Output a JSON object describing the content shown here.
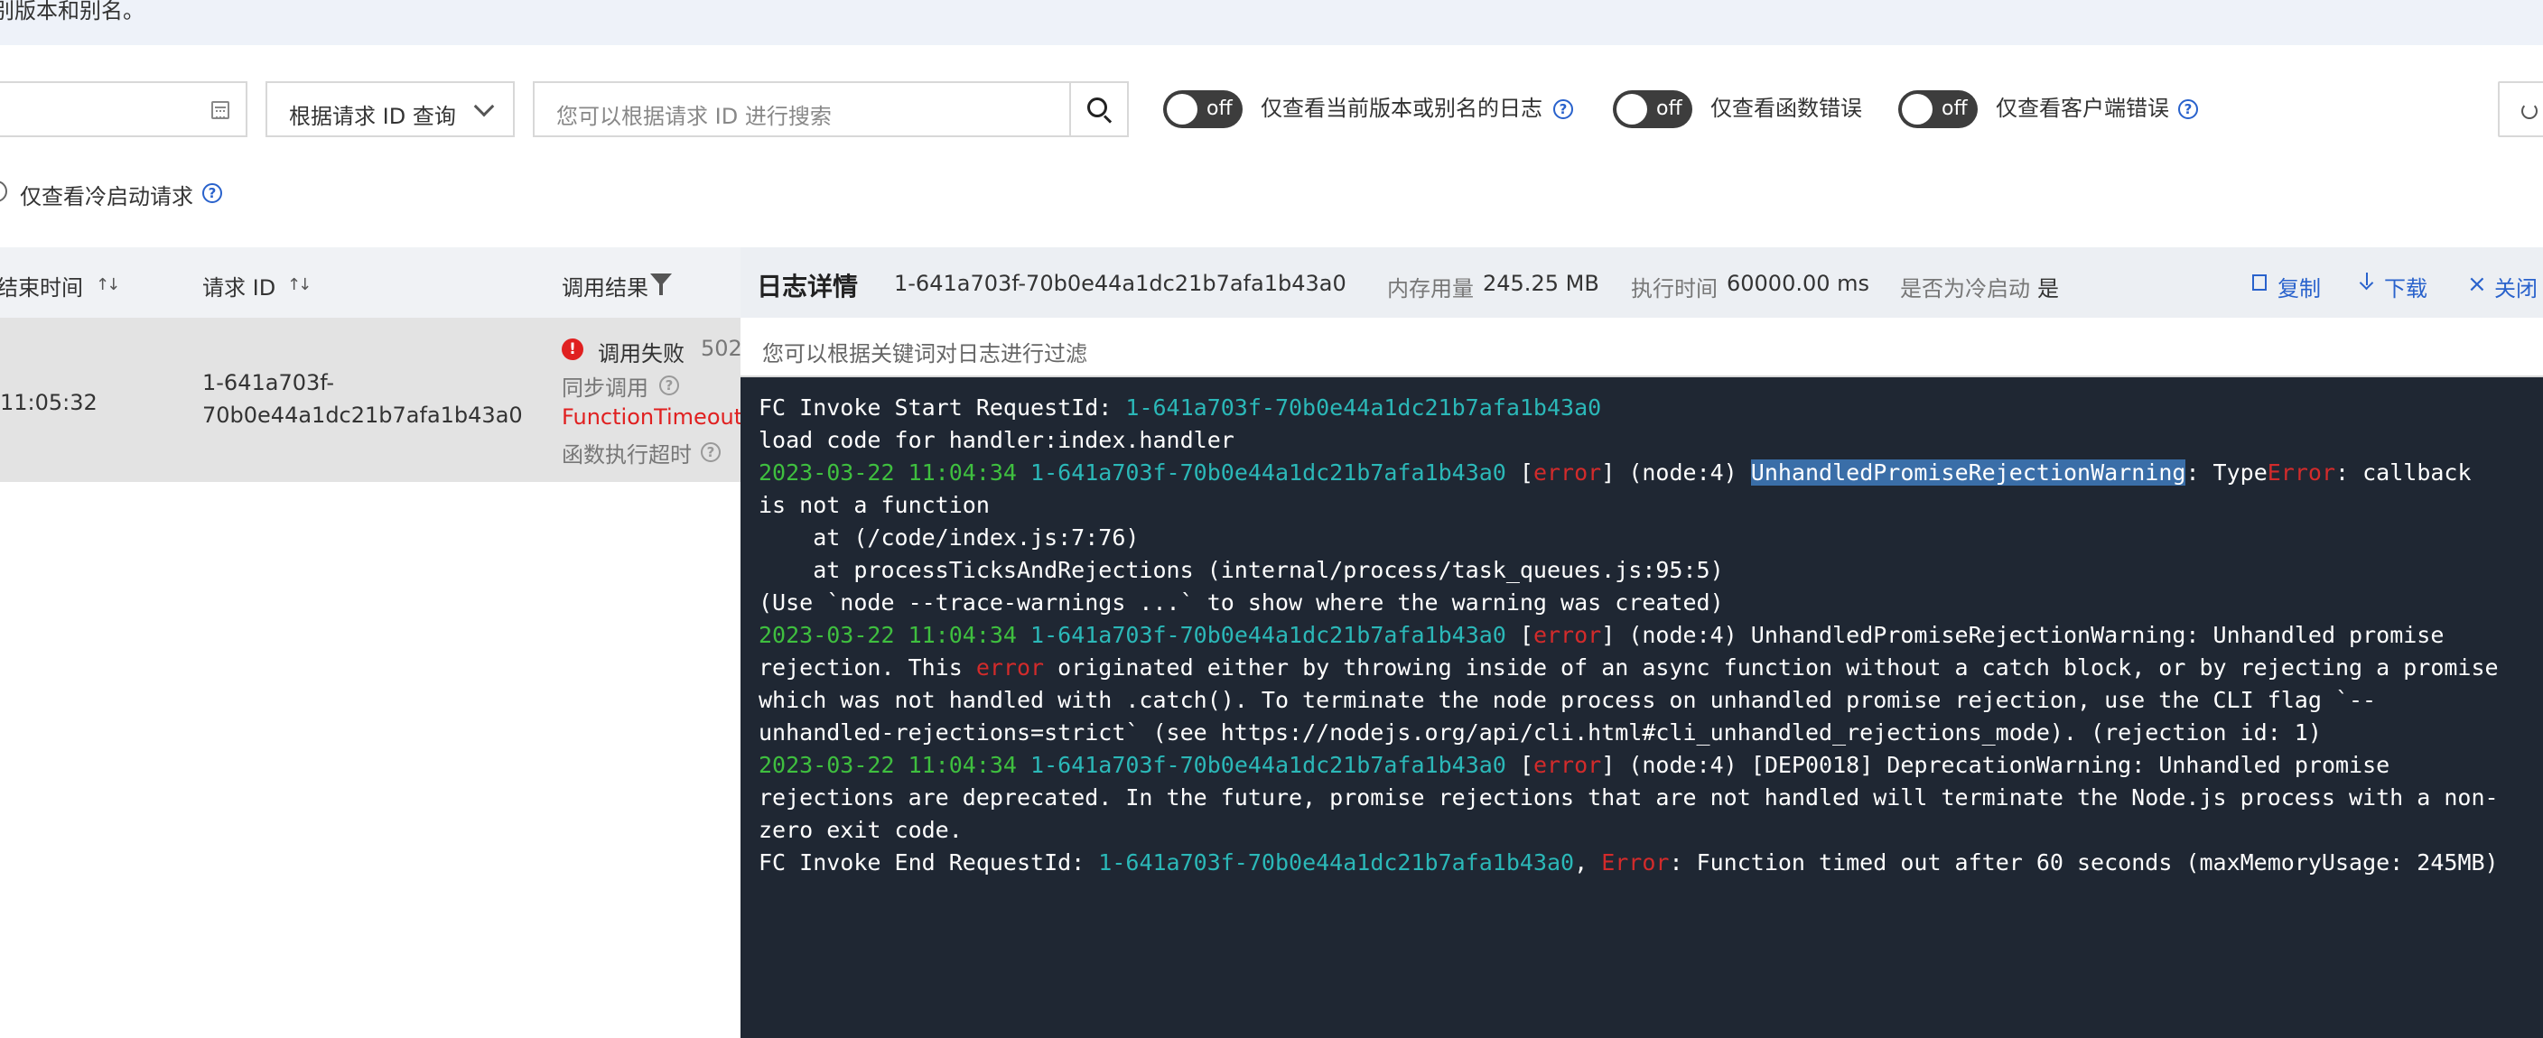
{
  "notice": {
    "text": "别版本和别名。"
  },
  "toolbar": {
    "date_value": "",
    "query_type": "根据请求 ID 查询",
    "search_placeholder": "您可以根据请求 ID 进行搜索",
    "toggle_off_label": "off",
    "toggle_version": "仅查看当前版本或别名的日志",
    "toggle_func_error": "仅查看函数错误",
    "toggle_client_error": "仅查看客户端错误",
    "cold_start": "仅查看冷启动请求"
  },
  "table": {
    "columns": [
      "结束时间",
      "请求 ID",
      "调用结果"
    ],
    "row": {
      "end_time": "11:05:32",
      "request_id_line1": "1-641a703f-",
      "request_id_line2": "70b0e44a1dc21b7afa1b43a0",
      "status": "调用失败",
      "status_code": "502",
      "invoke_type": "同步调用",
      "error_type": "FunctionTimeoutE",
      "error_desc": "函数执行超时"
    }
  },
  "panel": {
    "title": "日志详情",
    "request_id": "1-641a703f-70b0e44a1dc21b7afa1b43a0",
    "memory_label": "内存用量",
    "memory_value": "245.25 MB",
    "exec_label": "执行时间",
    "exec_value": "60000.00 ms",
    "cold_label": "是否为冷启动",
    "cold_value": "是",
    "copy": "复制",
    "download": "下载",
    "close": "关闭",
    "filter_placeholder": "您可以根据关键词对日志进行过滤"
  },
  "log": {
    "l1a": "FC Invoke Start RequestId: ",
    "rid": "1-641a703f-70b0e44a1dc21b7afa1b43a0",
    "l2": "load code for handler:index.handler",
    "ts": "2023-03-22 11:04:34",
    "err": "error",
    "l3b": "(node:4) ",
    "l3hl": "UnhandledPromiseRejectionWarning",
    "l3c": ": Type",
    "l3err": "Error",
    "l3d": ": callback",
    "l4": "is not a function",
    "l5": "    at (/code/index.js:7:76)",
    "l6": "    at processTicksAndRejections (internal/process/task_queues.js:95:5)",
    "l7": "(Use `node --trace-warnings ...` to show where the warning was created)",
    "l8b": "(node:4) UnhandledPromiseRejectionWarning: Unhandled promise",
    "l9a": "rejection. This ",
    "l9b": " originated either by throwing inside of an async function without a catch block, or by rejecting a promise",
    "l10": "which was not handled with .catch(). To terminate the node process on unhandled promise rejection, use the CLI flag `--",
    "l11": "unhandled-rejections=strict` (see https://nodejs.org/api/cli.html#cli_unhandled_rejections_mode). (rejection id: 1)",
    "l12b": "(node:4) [DEP0018] DeprecationWarning: Unhandled promise",
    "l13": "rejections are deprecated. In the future, promise rejections that are not handled will terminate the Node.js process with a non-",
    "l14": "zero exit code.",
    "l15a": "FC Invoke End RequestId: ",
    "l15b": "Error",
    "l15c": ": Function timed out after 60 seconds (maxMemoryUsage: 245MB)"
  }
}
